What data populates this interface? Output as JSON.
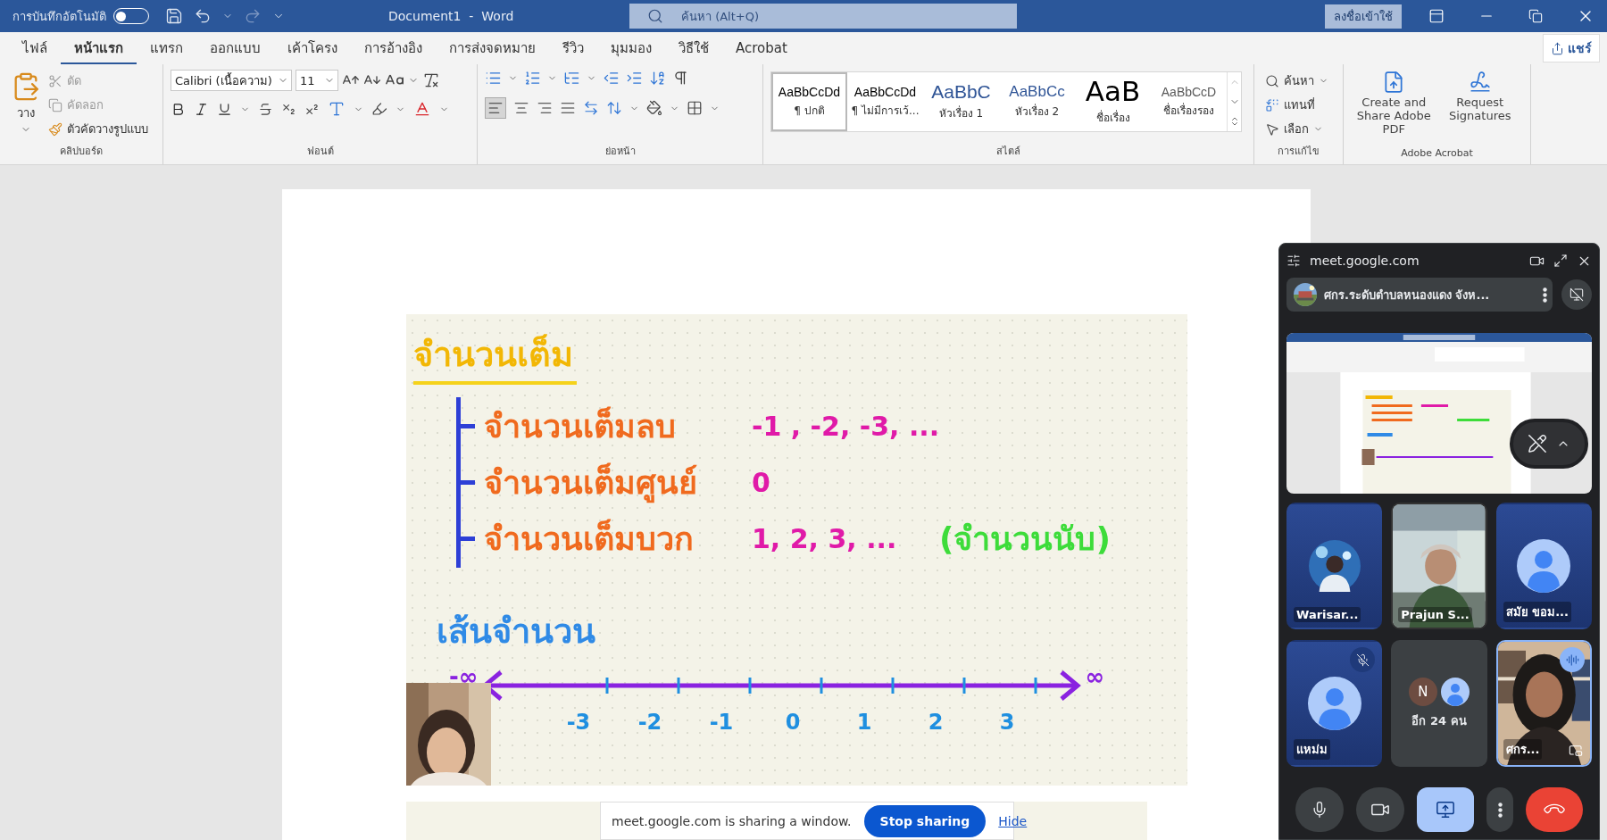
{
  "title_bar": {
    "autosave_label": "การบันทึกอัตโนมัติ",
    "autosave_on": false,
    "title": "Document1  -  Word",
    "search_placeholder": "ค้นหา (Alt+Q)",
    "sign_in": "ลงชื่อเข้าใช้"
  },
  "menu_tabs": [
    {
      "label": "ไฟล์",
      "selected": false
    },
    {
      "label": "หน้าแรก",
      "selected": true
    },
    {
      "label": "แทรก",
      "selected": false
    },
    {
      "label": "ออกแบบ",
      "selected": false
    },
    {
      "label": "เค้าโครง",
      "selected": false
    },
    {
      "label": "การอ้างอิง",
      "selected": false
    },
    {
      "label": "การส่งจดหมาย",
      "selected": false
    },
    {
      "label": "รีวิว",
      "selected": false
    },
    {
      "label": "มุมมอง",
      "selected": false
    },
    {
      "label": "วิธีใช้",
      "selected": false
    },
    {
      "label": "Acrobat",
      "selected": false
    }
  ],
  "share_button": "แชร์",
  "ribbon": {
    "clipboard": {
      "paste": "วาง",
      "cut": "ตัด",
      "copy": "คัดลอก",
      "format_painter": "ตัวคัดวางรูปแบบ",
      "label": "คลิปบอร์ด"
    },
    "font": {
      "font_name": "Calibri (เนื้อความ)",
      "font_size": "11",
      "label": "ฟอนต์"
    },
    "paragraph": {
      "label": "ย่อหน้า"
    },
    "styles": {
      "label": "สไตล์",
      "items": [
        {
          "sample": "AaBbCcDd",
          "name": "¶ ปกติ",
          "kind": "normal",
          "selected": true
        },
        {
          "sample": "AaBbCcDd",
          "name": "¶ ไม่มีการเว้...",
          "kind": "normal",
          "selected": false
        },
        {
          "sample": "AaBbC",
          "name": "หัวเรื่อง 1",
          "kind": "heading1",
          "selected": false
        },
        {
          "sample": "AaBbCc",
          "name": "หัวเรื่อง 2",
          "kind": "heading2",
          "selected": false
        },
        {
          "sample": "AaB",
          "name": "ชื่อเรื่อง",
          "kind": "title",
          "selected": false
        },
        {
          "sample": "AaBbCcD",
          "name": "ชื่อเรื่องรอง",
          "kind": "subtitle",
          "selected": false
        }
      ]
    },
    "editing": {
      "find": "ค้นหา",
      "replace": "แทนที่",
      "select": "เลือก",
      "label": "การแก้ไข"
    },
    "acrobat": {
      "buttons": [
        "Create and Share Adobe PDF",
        "Request Signatures"
      ],
      "label": "Adobe Acrobat"
    }
  },
  "document": {
    "title": "จำนวนเต็ม",
    "rows": [
      {
        "label": "จำนวนเต็มลบ",
        "values": "-1 , -2, -3, ..."
      },
      {
        "label": "จำนวนเต็มศูนย์",
        "values": "0"
      },
      {
        "label": "จำนวนเต็มบวก",
        "values": "1, 2, 3, ...",
        "note": "(จำนวนนับ)"
      }
    ],
    "number_line": {
      "title": "เส้นจำนวน",
      "left_end": "-∞",
      "right_end": "∞",
      "ticks": [
        "-3",
        "-2",
        "-1",
        "0",
        "1",
        "2",
        "3"
      ]
    }
  },
  "meet": {
    "title": "meet.google.com",
    "presenter": "ศกร.ระดับตำบลหนองแดง จังห...",
    "tiles": [
      {
        "name": "Warisar...",
        "muted": false,
        "speaking": false
      },
      {
        "kind": "video",
        "name": "Prajun S...",
        "muted": false,
        "speaking": false
      },
      {
        "kind": "avatar",
        "name": "สมัย ขอม...",
        "muted": false,
        "speaking": false
      },
      {
        "kind": "avatar",
        "name": "แหม่ม",
        "muted": true,
        "speaking": false
      },
      {
        "kind": "more",
        "initial": "N",
        "name": "อีก 24 คน",
        "muted": false,
        "speaking": false
      },
      {
        "kind": "video",
        "name": "ศกร...",
        "muted": false,
        "speaking": true
      }
    ],
    "presenting": true
  },
  "share_bar": {
    "message": "meet.google.com is sharing a window.",
    "stop": "Stop sharing",
    "hide": "Hide"
  }
}
